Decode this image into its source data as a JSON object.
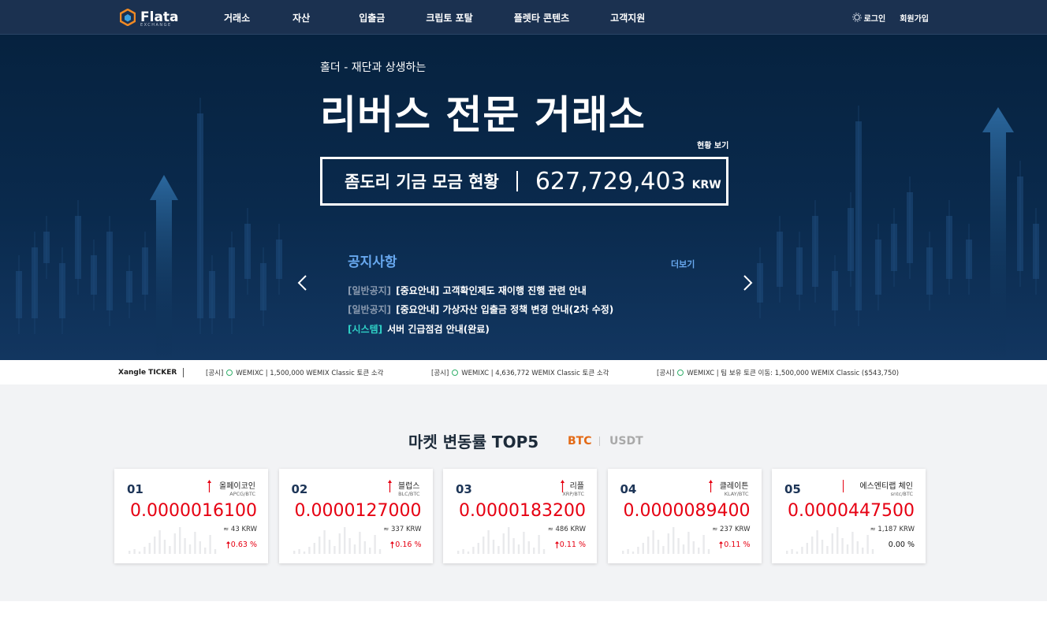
{
  "nav": {
    "logo_text": "Flata",
    "logo_sub": "EXCHANGE",
    "menu": [
      "거래소",
      "자산",
      "입출금",
      "크립토 포탈",
      "플렛타 콘텐츠",
      "고객지원"
    ],
    "login": "로그인",
    "signup": "회원가입"
  },
  "hero": {
    "subtitle": "홀더 - 재단과 상생하는",
    "title": "리버스 전문 거래소",
    "status_link": "현황 보기",
    "fund_label": "좀도리 기금 모금 현황",
    "fund_value": "627,729,403",
    "fund_unit": "KRW"
  },
  "notice": {
    "title": "공지사항",
    "more": "더보기",
    "items": [
      {
        "tag": "[일반공지]",
        "text": "[중요안내] 고객확인제도 재이행 진행 관련 안내"
      },
      {
        "tag": "[일반공지]",
        "text": "[중요안내] 가상자산 입출금 정책 변경 안내(2차 수정)"
      },
      {
        "tag": "[시스템]",
        "text": "서버 긴급점검 안내(완료)"
      }
    ]
  },
  "ticker": {
    "label": "Xangle TICKER",
    "items": [
      {
        "prefix": "[공시]",
        "text": "WEMIXC | 1,500,000 WEMIX Classic 토큰 소각"
      },
      {
        "prefix": "[공시]",
        "text": "WEMIXC | 4,636,772 WEMIX Classic 토큰 소각"
      },
      {
        "prefix": "[공시]",
        "text": "WEMIXC | 팀 보유 토큰 이동: 1,500,000 WEMIX Classic ($543,750)"
      }
    ]
  },
  "market": {
    "title": "마켓 변동률 TOP5",
    "tab_btc": "BTC",
    "tab_usdt": "USDT",
    "cards": [
      {
        "rank": "01",
        "name": "올페이코인",
        "pair": "APCG/BTC",
        "price": "0.0000016100",
        "krw": "≈ 43 KRW",
        "change": "0.63 %",
        "direction": "up"
      },
      {
        "rank": "02",
        "name": "블럽스",
        "pair": "BLC/BTC",
        "price": "0.0000127000",
        "krw": "≈ 337 KRW",
        "change": "0.16 %",
        "direction": "up"
      },
      {
        "rank": "03",
        "name": "리플",
        "pair": "XRP/BTC",
        "price": "0.0000183200",
        "krw": "≈ 486 KRW",
        "change": "0.11 %",
        "direction": "up"
      },
      {
        "rank": "04",
        "name": "클레이튼",
        "pair": "KLAY/BTC",
        "price": "0.0000089400",
        "krw": "≈ 237 KRW",
        "change": "0.11 %",
        "direction": "up"
      },
      {
        "rank": "05",
        "name": "에스엔티랩 체인",
        "pair": "sntc/BTC",
        "price": "0.0000447500",
        "krw": "≈ 1,187 KRW",
        "change": "0.00 %",
        "direction": "flat"
      }
    ]
  },
  "colors": {
    "nav_bg": "#1b3150",
    "hero_bg": "#0a2a4d",
    "notice_accent": "#68a8ef",
    "btc_tab": "#e36a16",
    "price_up": "#e60012"
  }
}
